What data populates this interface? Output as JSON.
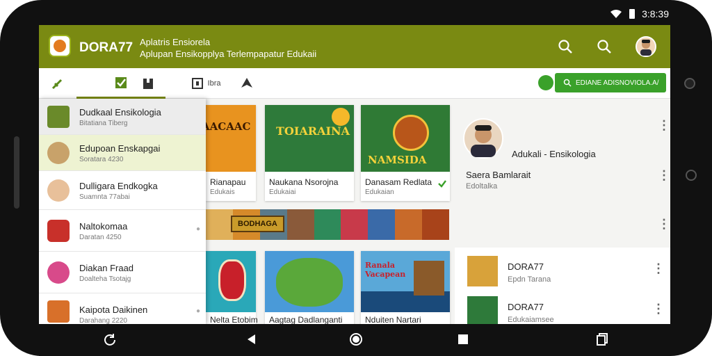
{
  "status_bar": {
    "time": "3:8:39"
  },
  "app_bar": {
    "app_name": "DORA77",
    "subtitle_line1": "Aplatris Ensiorela",
    "subtitle_line2": "Aplupan Ensikopplya Terlempapatur Edukaii"
  },
  "tabs": [
    {
      "icon": "leaf-icon",
      "label": ""
    },
    {
      "icon": "checklist-icon",
      "label": ""
    },
    {
      "icon": "book-icon",
      "label": ""
    },
    {
      "icon": "image-icon",
      "label": "Ibra"
    },
    {
      "icon": "home-icon",
      "label": ""
    }
  ],
  "search_chip": {
    "label": "EDIANE ADISNOVIOLA.A/"
  },
  "drawer": {
    "items": [
      {
        "title": "Dudkaal Ensikologia",
        "sub": "Bitatiana Tiberg"
      },
      {
        "title": "Edupoan Enskapgai",
        "sub": "Soratara 4230"
      },
      {
        "title": "Dulligara Endkogka",
        "sub": "Suamnta 77abai"
      },
      {
        "title": "Naltokomaa",
        "sub": "Daratan 4250"
      },
      {
        "title": "Diakan Fraad",
        "sub": "Doalteha Tsotajg"
      },
      {
        "title": "Kaipota Daikinen",
        "sub": "Darahang 2220"
      }
    ]
  },
  "cards_top": [
    {
      "title": "Rianapau",
      "sub": "Edukais",
      "poster_text": "AACAAC"
    },
    {
      "title": "Naukana Nsorojna",
      "sub": "Edukaiai",
      "poster_text": "TOIARAINA"
    },
    {
      "title": "Danasam Redlata",
      "sub": "Edukaian",
      "poster_text": "NAMSIDA"
    }
  ],
  "strip_label": "BODHAGA",
  "cards_bottom": [
    {
      "title": "Nelta Etobim",
      "poster_text": ""
    },
    {
      "title": "Aagtag Dadlanganti",
      "poster_text": ""
    },
    {
      "title": "Nduiten Nartari",
      "poster_text": "Ranala Vacapean"
    }
  ],
  "right_panel": {
    "heading": "Adukali - Ensikologia",
    "name": "Saera Bamlarait",
    "sub": "Edoltalka"
  },
  "right_list": [
    {
      "title": "DORA77",
      "sub": "Epdn Tarana"
    },
    {
      "title": "DORA77",
      "sub": "Edukaiamsee"
    }
  ],
  "colors": {
    "primary": "#7a8a12",
    "accent_green": "#3aa12a",
    "highlight": "#eef3d2"
  }
}
